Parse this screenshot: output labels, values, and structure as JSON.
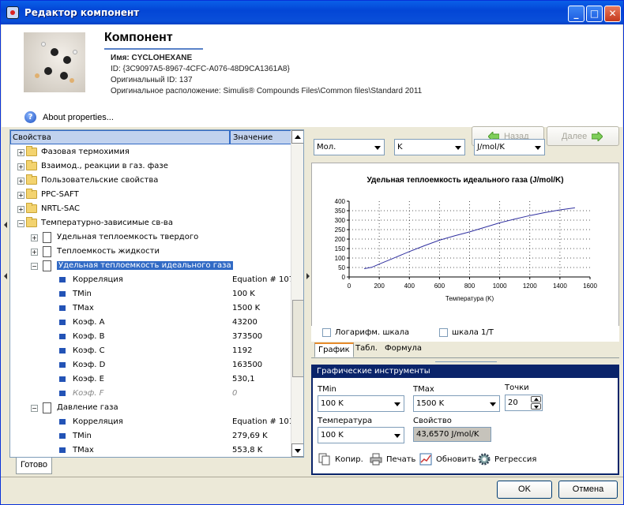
{
  "window": {
    "title": "Редактор компонент",
    "minimize": "_",
    "maximize": "□",
    "close": "✕"
  },
  "component": {
    "heading": "Компонент",
    "name_line": "Имя: CYCLOHEXANE",
    "id_line": "ID: {3C9097A5-8967-4CFC-A076-48D9CA1361A8}",
    "orig_id_line": "Оригинальный ID: 137",
    "location_line": "Оригинальное расположение: Simulis® Compounds Files\\Common files\\Standard 2011"
  },
  "about_label": "About properties...",
  "nav": {
    "back": "Назад",
    "next": "Далее"
  },
  "tree": {
    "col_property": "Свойства",
    "col_value": "Значение",
    "rows": [
      {
        "label": "Фазовая термохимия"
      },
      {
        "label": "Взаимод., реакции в газ. фазе"
      },
      {
        "label": "Пользовательские свойства"
      },
      {
        "label": "PPC-SAFT"
      },
      {
        "label": "NRTL-SAC"
      },
      {
        "label": "Температурно-зависимые св-ва"
      },
      {
        "label": "Удельная теплоемкость твердого"
      },
      {
        "label": "Теплоемкость жидкости"
      },
      {
        "label": "Удельная теплоемкость идеального газа"
      },
      {
        "label": "Корреляция",
        "value": "Equation # 107"
      },
      {
        "label": "TMin",
        "value": "100 K"
      },
      {
        "label": "TMax",
        "value": "1500 K"
      },
      {
        "label": "Коэф. A",
        "value": "43200"
      },
      {
        "label": "Коэф. B",
        "value": "373500"
      },
      {
        "label": "Коэф. C",
        "value": "1192"
      },
      {
        "label": "Коэф. D",
        "value": "163500"
      },
      {
        "label": "Коэф. E",
        "value": "530,1"
      },
      {
        "label": "Коэф. F",
        "value": "0"
      },
      {
        "label": "Давление газа"
      },
      {
        "label": "Корреляция",
        "value": "Equation # 101"
      },
      {
        "label": "TMin",
        "value": "279,69 K"
      },
      {
        "label": "TMax",
        "value": "553,8 K"
      }
    ]
  },
  "status": "Готово",
  "units": {
    "amount": "Мол.",
    "temperature": "K",
    "cp": "J/mol/K"
  },
  "chart_data": {
    "type": "line",
    "title": "Удельная теплоемкость идеального газа (J/mol/K)",
    "xlabel": "Температура (K)",
    "ylabel": "",
    "xlim": [
      0,
      1600
    ],
    "ylim": [
      0,
      400
    ],
    "x_ticks": [
      "0",
      "200",
      "400",
      "600",
      "800",
      "1000",
      "1200",
      "1400",
      "1600"
    ],
    "y_ticks": [
      "0",
      "50",
      "100",
      "150",
      "200",
      "250",
      "300",
      "350",
      "400"
    ],
    "grid": true,
    "series": [
      {
        "color": "#3030a0",
        "x": [
          100,
          150,
          200,
          300,
          400,
          500,
          600,
          700,
          800,
          900,
          1000,
          1100,
          1200,
          1300,
          1400,
          1500
        ],
        "values": [
          43.7,
          51,
          68,
          101,
          134,
          165,
          194,
          217,
          238,
          262,
          286,
          306,
          324,
          340,
          354,
          365
        ]
      }
    ]
  },
  "log_scale_label": "Логарифм. шкала",
  "inv_scale_label": "шкала 1/T",
  "tabs": [
    "График",
    "Табл.",
    "Формула"
  ],
  "tools": {
    "header": "Графические инструменты",
    "tmin_label": "TMin",
    "tmin_value": "100 K",
    "tmax_label": "TMax",
    "tmax_value": "1500 K",
    "points_label": "Точки",
    "points_value": "20",
    "temp_label": "Температура",
    "temp_value": "100 K",
    "prop_label": "Свойство",
    "prop_value": "43,6570 J/mol/K",
    "copy": "Копир.",
    "print": "Печать",
    "refresh": "Обновить",
    "regression": "Регрессия"
  },
  "buttons": {
    "ok": "OK",
    "cancel": "Отмена"
  }
}
